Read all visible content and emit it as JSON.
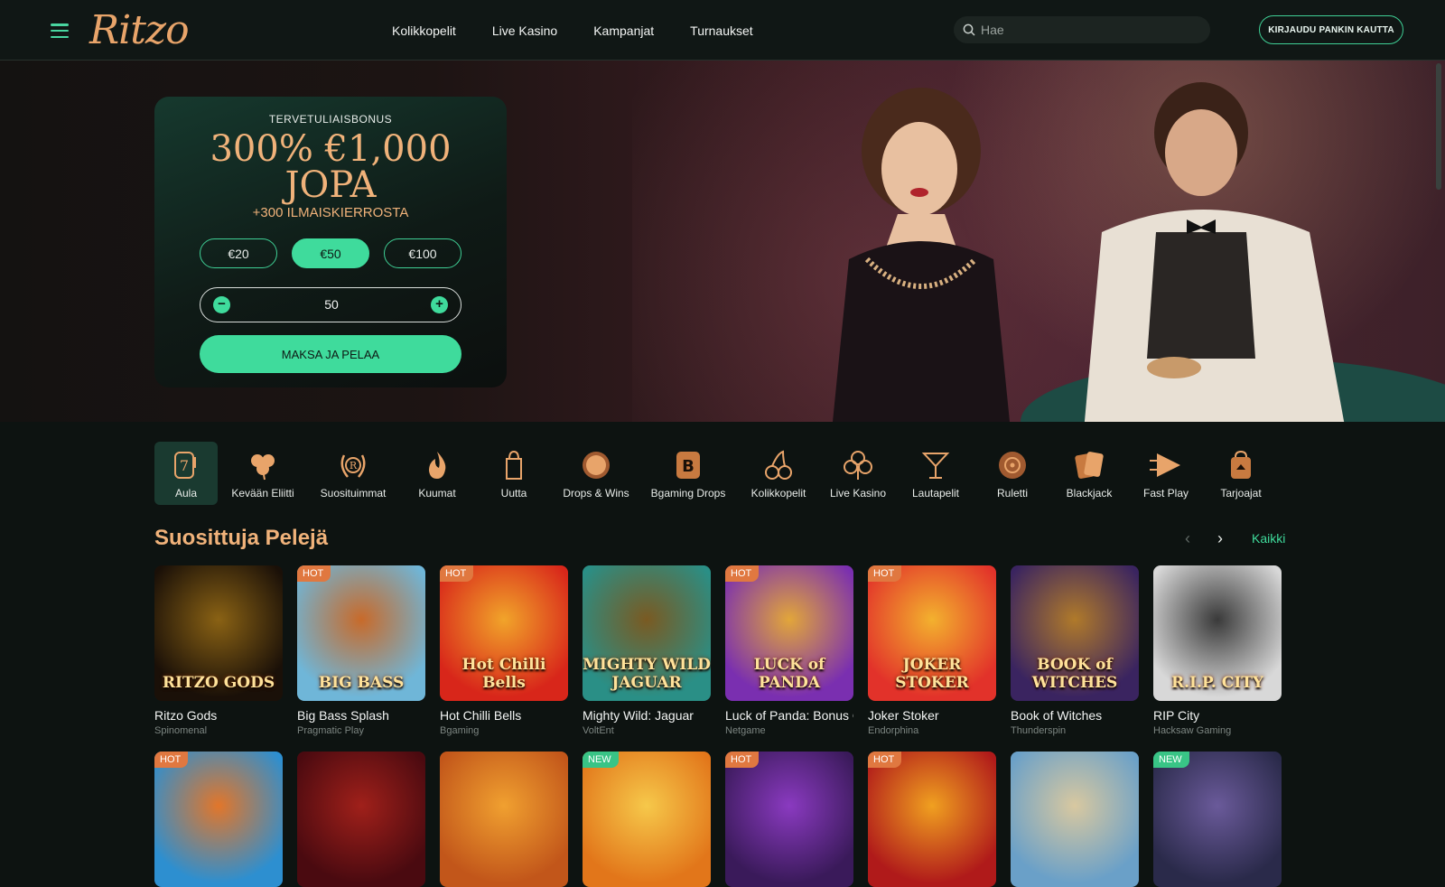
{
  "header": {
    "logo": "Ritzo",
    "nav": [
      "Kolikkopelit",
      "Live Kasino",
      "Kampanjat",
      "Turnaukset"
    ],
    "search_placeholder": "Hae",
    "login_label": "KIRJAUDU PANKIN KAUTTA"
  },
  "promo": {
    "kicker": "TERVETULIAISBONUS",
    "headline_line1": "300% €1,000",
    "headline_line2": "JOPA",
    "subline": "+300 ILMAISKIERROSTA",
    "amounts": [
      "€20",
      "€50",
      "€100"
    ],
    "selected_amount": "€50",
    "stepper_value": "50",
    "minus": "−",
    "plus": "+",
    "pay_label": "MAKSA JA PELAA"
  },
  "categories": [
    {
      "label": "Aula",
      "icon": "slot-machine-icon",
      "active": true
    },
    {
      "label": "Kevään Eliitti",
      "icon": "clover-icon"
    },
    {
      "label": "Suosituimmat",
      "icon": "laurel-icon"
    },
    {
      "label": "Kuumat",
      "icon": "flame-icon"
    },
    {
      "label": "Uutta",
      "icon": "new-tag-icon"
    },
    {
      "label": "Drops & Wins",
      "icon": "drops-wins-icon"
    },
    {
      "label": "Bgaming Drops",
      "icon": "bgaming-icon"
    },
    {
      "label": "Kolikkopelit",
      "icon": "cherries-icon"
    },
    {
      "label": "Live Kasino",
      "icon": "club-icon"
    },
    {
      "label": "Lautapelit",
      "icon": "cocktail-icon"
    },
    {
      "label": "Ruletti",
      "icon": "roulette-icon"
    },
    {
      "label": "Blackjack",
      "icon": "cards-icon"
    },
    {
      "label": "Fast Play",
      "icon": "fast-play-icon"
    },
    {
      "label": "Tarjoajat",
      "icon": "provider-icon"
    }
  ],
  "section": {
    "title": "Suosittuja Pelejä",
    "all_label": "Kaikki"
  },
  "games": [
    {
      "name": "Ritzo Gods",
      "provider": "Spinomenal",
      "badge": "",
      "art": "RITZO GODS",
      "c1": "#1a1008",
      "c2": "#8a6214"
    },
    {
      "name": "Big Bass Splash",
      "provider": "Pragmatic Play",
      "badge": "HOT",
      "art": "BIG BASS",
      "c1": "#6fb6d8",
      "c2": "#c86a2a"
    },
    {
      "name": "Hot Chilli Bells",
      "provider": "Bgaming",
      "badge": "HOT",
      "art": "Hot Chilli Bells",
      "c1": "#d8261a",
      "c2": "#f1a42a"
    },
    {
      "name": "Mighty Wild: Jaguar",
      "provider": "VoltEnt",
      "badge": "",
      "art": "MIGHTY WILD JAGUAR",
      "c1": "#2a8f86",
      "c2": "#7a5a22"
    },
    {
      "name": "Luck of Panda: Bonus Combo",
      "provider": "Netgame",
      "badge": "HOT",
      "art": "LUCK of PANDA",
      "c1": "#7a2fb0",
      "c2": "#e2a63a"
    },
    {
      "name": "Joker Stoker",
      "provider": "Endorphina",
      "badge": "HOT",
      "art": "JOKER STOKER",
      "c1": "#e2322a",
      "c2": "#f3b12e"
    },
    {
      "name": "Book of Witches",
      "provider": "Thunderspin",
      "badge": "",
      "art": "BOOK of WITCHES",
      "c1": "#3a2460",
      "c2": "#b07a2a"
    },
    {
      "name": "RIP City",
      "provider": "Hacksaw Gaming",
      "badge": "",
      "art": "R.I.P. CITY",
      "c1": "#d8d8d8",
      "c2": "#3a3a3a"
    }
  ],
  "games_row2": [
    {
      "badge": "HOT",
      "c1": "#2d8fd0",
      "c2": "#e2762a"
    },
    {
      "badge": "",
      "c1": "#4a0a10",
      "c2": "#a0201a"
    },
    {
      "badge": "",
      "c1": "#c2561a",
      "c2": "#f0a030"
    },
    {
      "badge": "NEW",
      "c1": "#e2761a",
      "c2": "#f6c84a"
    },
    {
      "badge": "HOT",
      "c1": "#3a1a5a",
      "c2": "#8a3ac0"
    },
    {
      "badge": "HOT",
      "c1": "#b01a1a",
      "c2": "#f0a020"
    },
    {
      "badge": "",
      "c1": "#6aa0c8",
      "c2": "#d8c8a0"
    },
    {
      "badge": "NEW",
      "c1": "#2a2a4a",
      "c2": "#6a5a9a"
    }
  ],
  "colors": {
    "accent": "#3fdb9c",
    "brand": "#f0b27a",
    "hot": "#e07840",
    "new": "#39c486"
  }
}
